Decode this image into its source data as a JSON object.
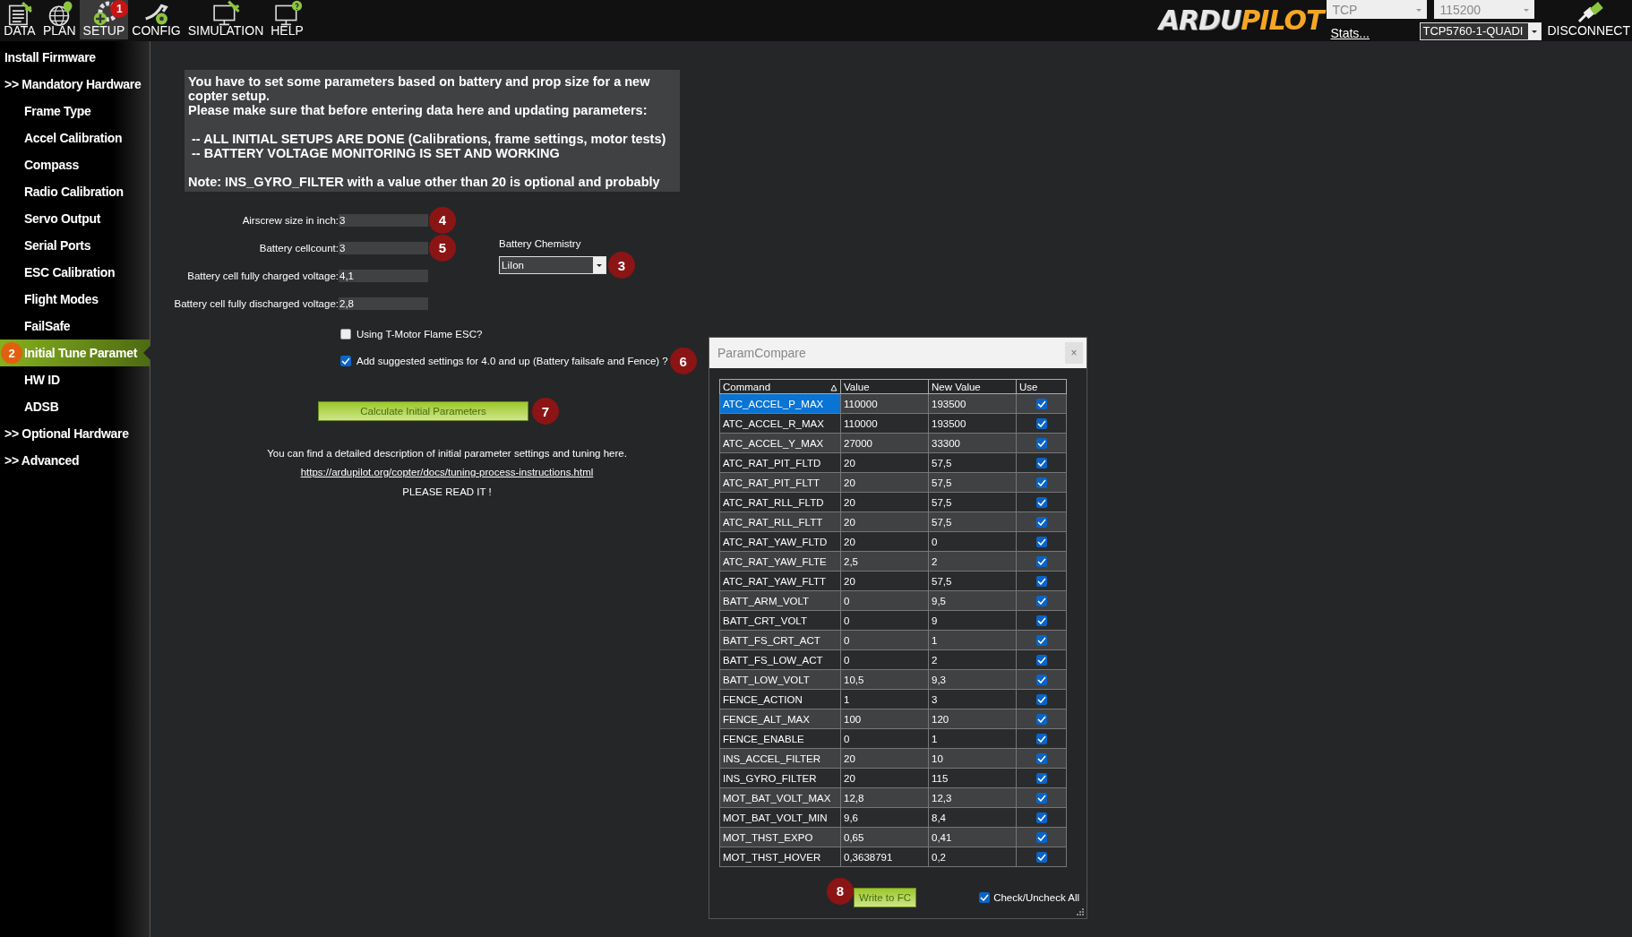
{
  "toolbar": {
    "tabs": [
      {
        "label": "DATA",
        "kind": "data",
        "selected": false
      },
      {
        "label": "PLAN",
        "kind": "plan",
        "selected": false
      },
      {
        "label": "SETUP",
        "kind": "setup",
        "selected": true,
        "callout": "1"
      },
      {
        "label": "CONFIG",
        "kind": "config",
        "selected": false
      },
      {
        "label": "SIMULATION",
        "kind": "simulation",
        "selected": false
      },
      {
        "label": "HELP",
        "kind": "help",
        "selected": false
      }
    ],
    "logo": {
      "part_1": "ARDU",
      "part_2": "PILOT"
    },
    "connection": {
      "link_type": "TCP",
      "baud_rate": "115200",
      "stats_link": "Stats...",
      "port": "TCP5760-1-QUADI",
      "connect_button": "DISCONNECT"
    }
  },
  "sidebar": {
    "items": [
      {
        "label": "Install Firmware",
        "selected": false
      },
      {
        "label": ">> Mandatory Hardware",
        "selected": false,
        "children": [
          {
            "label": "Frame Type",
            "selected": false
          },
          {
            "label": "Accel Calibration",
            "selected": false
          },
          {
            "label": "Compass",
            "selected": false
          },
          {
            "label": "Radio Calibration",
            "selected": false
          },
          {
            "label": "Servo Output",
            "selected": false
          },
          {
            "label": "Serial Ports",
            "selected": false
          },
          {
            "label": "ESC Calibration",
            "selected": false
          },
          {
            "label": "Flight Modes",
            "selected": false
          },
          {
            "label": "FailSafe",
            "selected": false
          },
          {
            "label": "Initial Tune Paramet",
            "selected": true,
            "callout": "2"
          },
          {
            "label": "HW ID",
            "selected": false
          },
          {
            "label": "ADSB",
            "selected": false
          }
        ]
      },
      {
        "label": ">> Optional Hardware",
        "selected": false
      },
      {
        "label": ">> Advanced",
        "selected": false
      }
    ]
  },
  "intro": {
    "paragraphs": [
      [
        "You have to set some parameters based on battery and prop size for a new copter setup.",
        "Please make sure that before entering data here and updating parameters:"
      ],
      [
        " -- ALL INITIAL SETUPS ARE DONE (Calibrations, frame settings, motor tests)",
        " -- BATTERY VOLTAGE MONITORING IS SET AND WORKING"
      ],
      [
        "Note: INS_GYRO_FILTER with a value other than 20 is optional and probably"
      ]
    ]
  },
  "fields": [
    {
      "label": "Airscrew size in inch:",
      "value": "3",
      "callout": "4"
    },
    {
      "label": "Battery cellcount:",
      "value": "3",
      "callout": "5"
    },
    {
      "label": "Battery cell fully charged voltage:",
      "value": "4,1"
    },
    {
      "label": "Battery cell fully discharged voltage:",
      "value": "2,8"
    }
  ],
  "battery_chemistry": {
    "label": "Battery Chemistry",
    "value": "LiIon",
    "callout": "3"
  },
  "options": [
    {
      "label": "Using T-Motor Flame ESC?",
      "checked": false
    },
    {
      "label": "Add suggested settings for 4.0 and up (Battery failsafe and Fence) ?",
      "checked": true,
      "callout": "6"
    }
  ],
  "calculate_button": {
    "label": "Calculate Initial Parameters",
    "callout": "7"
  },
  "help": {
    "text": "You can find a detailed description of initial parameter settings and tuning here.",
    "link": "https://ardupilot.org/copter/docs/tuning-process-instructions.html",
    "note": "PLEASE READ IT !"
  },
  "dialog": {
    "title": "ParamCompare",
    "close_button": "×",
    "columns": [
      {
        "label": "Command",
        "sorted_ascending": true
      },
      {
        "label": "Value"
      },
      {
        "label": "New Value"
      },
      {
        "label": "Use"
      }
    ],
    "rows": [
      {
        "command": "ATC_ACCEL_P_MAX",
        "value": "110000",
        "new_value": "193500",
        "use": true,
        "selected": true
      },
      {
        "command": "ATC_ACCEL_R_MAX",
        "value": "110000",
        "new_value": "193500",
        "use": true,
        "selected": false
      },
      {
        "command": "ATC_ACCEL_Y_MAX",
        "value": "27000",
        "new_value": "33300",
        "use": true,
        "selected": false
      },
      {
        "command": "ATC_RAT_PIT_FLTD",
        "value": "20",
        "new_value": "57,5",
        "use": true,
        "selected": false
      },
      {
        "command": "ATC_RAT_PIT_FLTT",
        "value": "20",
        "new_value": "57,5",
        "use": true,
        "selected": false
      },
      {
        "command": "ATC_RAT_RLL_FLTD",
        "value": "20",
        "new_value": "57,5",
        "use": true,
        "selected": false
      },
      {
        "command": "ATC_RAT_RLL_FLTT",
        "value": "20",
        "new_value": "57,5",
        "use": true,
        "selected": false
      },
      {
        "command": "ATC_RAT_YAW_FLTD",
        "value": "20",
        "new_value": "0",
        "use": true,
        "selected": false
      },
      {
        "command": "ATC_RAT_YAW_FLTE",
        "value": "2,5",
        "new_value": "2",
        "use": true,
        "selected": false
      },
      {
        "command": "ATC_RAT_YAW_FLTT",
        "value": "20",
        "new_value": "57,5",
        "use": true,
        "selected": false
      },
      {
        "command": "BATT_ARM_VOLT",
        "value": "0",
        "new_value": "9,5",
        "use": true,
        "selected": false
      },
      {
        "command": "BATT_CRT_VOLT",
        "value": "0",
        "new_value": "9",
        "use": true,
        "selected": false
      },
      {
        "command": "BATT_FS_CRT_ACT",
        "value": "0",
        "new_value": "1",
        "use": true,
        "selected": false
      },
      {
        "command": "BATT_FS_LOW_ACT",
        "value": "0",
        "new_value": "2",
        "use": true,
        "selected": false
      },
      {
        "command": "BATT_LOW_VOLT",
        "value": "10,5",
        "new_value": "9,3",
        "use": true,
        "selected": false
      },
      {
        "command": "FENCE_ACTION",
        "value": "1",
        "new_value": "3",
        "use": true,
        "selected": false
      },
      {
        "command": "FENCE_ALT_MAX",
        "value": "100",
        "new_value": "120",
        "use": true,
        "selected": false
      },
      {
        "command": "FENCE_ENABLE",
        "value": "0",
        "new_value": "1",
        "use": true,
        "selected": false
      },
      {
        "command": "INS_ACCEL_FILTER",
        "value": "20",
        "new_value": "10",
        "use": true,
        "selected": false
      },
      {
        "command": "INS_GYRO_FILTER",
        "value": "20",
        "new_value": "115",
        "use": true,
        "selected": false
      },
      {
        "command": "MOT_BAT_VOLT_MAX",
        "value": "12,8",
        "new_value": "12,3",
        "use": true,
        "selected": false
      },
      {
        "command": "MOT_BAT_VOLT_MIN",
        "value": "9,6",
        "new_value": "8,4",
        "use": true,
        "selected": false
      },
      {
        "command": "MOT_THST_EXPO",
        "value": "0,65",
        "new_value": "0,41",
        "use": true,
        "selected": false
      },
      {
        "command": "MOT_THST_HOVER",
        "value": "0,3638791",
        "new_value": "0,2",
        "use": true,
        "selected": false
      }
    ],
    "write_button": {
      "label": "Write to FC",
      "callout": "8"
    },
    "check_all": {
      "label": "Check/Uncheck All",
      "checked": true
    }
  }
}
